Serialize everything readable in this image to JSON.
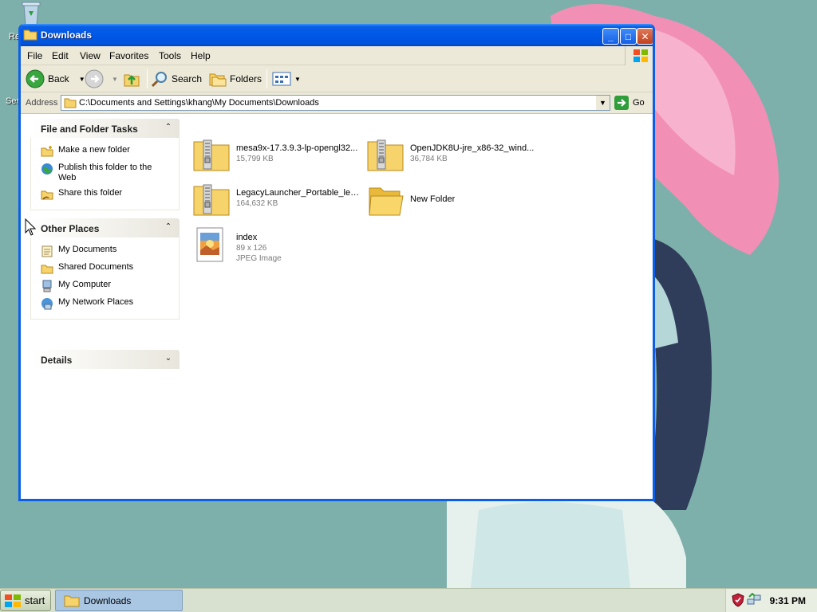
{
  "desktop": {
    "label_1": "Re",
    "label_2": "Ser"
  },
  "window": {
    "title": "Downloads",
    "controls": {
      "minimize": "_",
      "maximize": "□",
      "close": "✕"
    }
  },
  "menubar": {
    "items": [
      "File",
      "Edit",
      "View",
      "Favorites",
      "Tools",
      "Help"
    ]
  },
  "toolbar": {
    "back_label": "Back",
    "search_label": "Search",
    "folders_label": "Folders"
  },
  "address": {
    "label": "Address",
    "path": "C:\\Documents and Settings\\khang\\My Documents\\Downloads",
    "go_label": "Go"
  },
  "taskpane": {
    "file_tasks": {
      "title": "File and Folder Tasks",
      "items": [
        "Make a new folder",
        "Publish this folder to the Web",
        "Share this folder"
      ]
    },
    "other_places": {
      "title": "Other Places",
      "items": [
        "My Documents",
        "Shared Documents",
        "My Computer",
        "My Network Places"
      ]
    },
    "details": {
      "title": "Details"
    }
  },
  "files": [
    {
      "name": "mesa9x-17.3.9.3-lp-opengl32...",
      "meta": "15,799 KB",
      "icon": "zip-folder-icon"
    },
    {
      "name": "OpenJDK8U-jre_x86-32_wind...",
      "meta": "36,784 KB",
      "icon": "zip-folder-icon"
    },
    {
      "name": "LegacyLauncher_Portable_leg...",
      "meta": "164,632 KB",
      "icon": "zip-folder-icon"
    },
    {
      "name": "New Folder",
      "meta": "",
      "icon": "folder-icon"
    },
    {
      "name": "index",
      "meta": "89 x 126",
      "meta2": "JPEG Image",
      "icon": "jpeg-image-icon"
    }
  ],
  "taskbar": {
    "start_label": "start",
    "task_label": "Downloads",
    "clock": "9:31 PM"
  },
  "colors": {
    "desktop": "#7eb0ab",
    "titlebar": "#0058e6",
    "chrome": "#ece9d8"
  }
}
